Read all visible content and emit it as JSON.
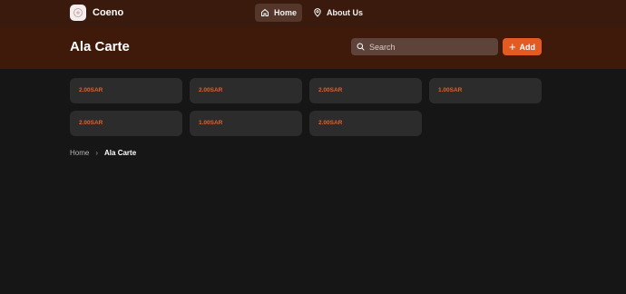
{
  "brand": {
    "name": "Coeno"
  },
  "nav": {
    "home_label": "Home",
    "about_label": "About Us"
  },
  "page": {
    "title": "Ala Carte"
  },
  "search": {
    "placeholder": "Search"
  },
  "toolbar": {
    "add_label": "Add"
  },
  "items": [
    {
      "price": "2.00SAR"
    },
    {
      "price": "2.00SAR"
    },
    {
      "price": "2.00SAR"
    },
    {
      "price": "1.00SAR"
    },
    {
      "price": "2.00SAR"
    },
    {
      "price": "1.00SAR"
    },
    {
      "price": "2.00SAR"
    }
  ],
  "breadcrumb": {
    "home": "Home",
    "separator": "›",
    "current": "Ala Carte"
  },
  "colors": {
    "accent": "#e35b22",
    "header_bg": "#3f1a0a",
    "page_bg": "#161616",
    "card_bg": "#2c2c2c"
  }
}
